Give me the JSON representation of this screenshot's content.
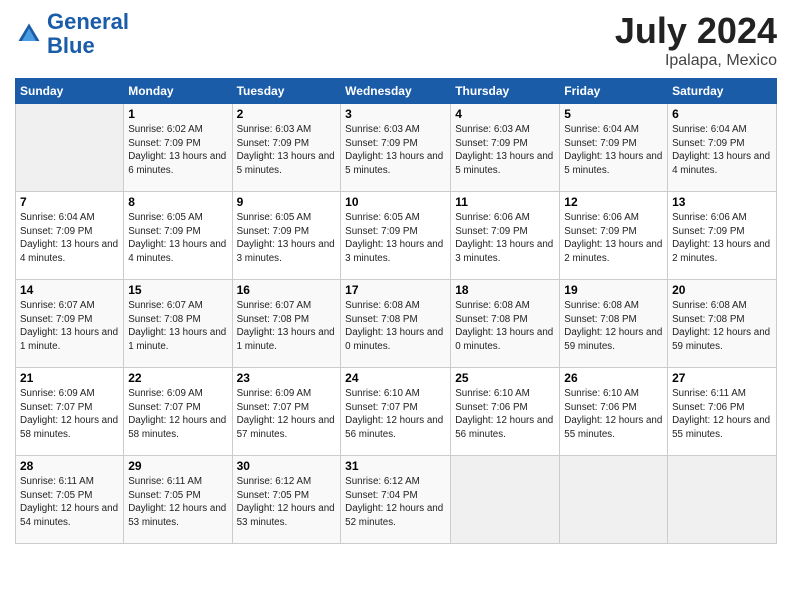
{
  "header": {
    "logo_line1": "General",
    "logo_line2": "Blue",
    "month": "July 2024",
    "location": "Ipalapa, Mexico"
  },
  "days_of_week": [
    "Sunday",
    "Monday",
    "Tuesday",
    "Wednesday",
    "Thursday",
    "Friday",
    "Saturday"
  ],
  "weeks": [
    [
      {
        "day": "",
        "empty": true
      },
      {
        "day": "1",
        "sunrise": "Sunrise: 6:02 AM",
        "sunset": "Sunset: 7:09 PM",
        "daylight": "Daylight: 13 hours and 6 minutes."
      },
      {
        "day": "2",
        "sunrise": "Sunrise: 6:03 AM",
        "sunset": "Sunset: 7:09 PM",
        "daylight": "Daylight: 13 hours and 5 minutes."
      },
      {
        "day": "3",
        "sunrise": "Sunrise: 6:03 AM",
        "sunset": "Sunset: 7:09 PM",
        "daylight": "Daylight: 13 hours and 5 minutes."
      },
      {
        "day": "4",
        "sunrise": "Sunrise: 6:03 AM",
        "sunset": "Sunset: 7:09 PM",
        "daylight": "Daylight: 13 hours and 5 minutes."
      },
      {
        "day": "5",
        "sunrise": "Sunrise: 6:04 AM",
        "sunset": "Sunset: 7:09 PM",
        "daylight": "Daylight: 13 hours and 5 minutes."
      },
      {
        "day": "6",
        "sunrise": "Sunrise: 6:04 AM",
        "sunset": "Sunset: 7:09 PM",
        "daylight": "Daylight: 13 hours and 4 minutes."
      }
    ],
    [
      {
        "day": "7",
        "sunrise": "Sunrise: 6:04 AM",
        "sunset": "Sunset: 7:09 PM",
        "daylight": "Daylight: 13 hours and 4 minutes."
      },
      {
        "day": "8",
        "sunrise": "Sunrise: 6:05 AM",
        "sunset": "Sunset: 7:09 PM",
        "daylight": "Daylight: 13 hours and 4 minutes."
      },
      {
        "day": "9",
        "sunrise": "Sunrise: 6:05 AM",
        "sunset": "Sunset: 7:09 PM",
        "daylight": "Daylight: 13 hours and 3 minutes."
      },
      {
        "day": "10",
        "sunrise": "Sunrise: 6:05 AM",
        "sunset": "Sunset: 7:09 PM",
        "daylight": "Daylight: 13 hours and 3 minutes."
      },
      {
        "day": "11",
        "sunrise": "Sunrise: 6:06 AM",
        "sunset": "Sunset: 7:09 PM",
        "daylight": "Daylight: 13 hours and 3 minutes."
      },
      {
        "day": "12",
        "sunrise": "Sunrise: 6:06 AM",
        "sunset": "Sunset: 7:09 PM",
        "daylight": "Daylight: 13 hours and 2 minutes."
      },
      {
        "day": "13",
        "sunrise": "Sunrise: 6:06 AM",
        "sunset": "Sunset: 7:09 PM",
        "daylight": "Daylight: 13 hours and 2 minutes."
      }
    ],
    [
      {
        "day": "14",
        "sunrise": "Sunrise: 6:07 AM",
        "sunset": "Sunset: 7:09 PM",
        "daylight": "Daylight: 13 hours and 1 minute."
      },
      {
        "day": "15",
        "sunrise": "Sunrise: 6:07 AM",
        "sunset": "Sunset: 7:08 PM",
        "daylight": "Daylight: 13 hours and 1 minute."
      },
      {
        "day": "16",
        "sunrise": "Sunrise: 6:07 AM",
        "sunset": "Sunset: 7:08 PM",
        "daylight": "Daylight: 13 hours and 1 minute."
      },
      {
        "day": "17",
        "sunrise": "Sunrise: 6:08 AM",
        "sunset": "Sunset: 7:08 PM",
        "daylight": "Daylight: 13 hours and 0 minutes."
      },
      {
        "day": "18",
        "sunrise": "Sunrise: 6:08 AM",
        "sunset": "Sunset: 7:08 PM",
        "daylight": "Daylight: 13 hours and 0 minutes."
      },
      {
        "day": "19",
        "sunrise": "Sunrise: 6:08 AM",
        "sunset": "Sunset: 7:08 PM",
        "daylight": "Daylight: 12 hours and 59 minutes."
      },
      {
        "day": "20",
        "sunrise": "Sunrise: 6:08 AM",
        "sunset": "Sunset: 7:08 PM",
        "daylight": "Daylight: 12 hours and 59 minutes."
      }
    ],
    [
      {
        "day": "21",
        "sunrise": "Sunrise: 6:09 AM",
        "sunset": "Sunset: 7:07 PM",
        "daylight": "Daylight: 12 hours and 58 minutes."
      },
      {
        "day": "22",
        "sunrise": "Sunrise: 6:09 AM",
        "sunset": "Sunset: 7:07 PM",
        "daylight": "Daylight: 12 hours and 58 minutes."
      },
      {
        "day": "23",
        "sunrise": "Sunrise: 6:09 AM",
        "sunset": "Sunset: 7:07 PM",
        "daylight": "Daylight: 12 hours and 57 minutes."
      },
      {
        "day": "24",
        "sunrise": "Sunrise: 6:10 AM",
        "sunset": "Sunset: 7:07 PM",
        "daylight": "Daylight: 12 hours and 56 minutes."
      },
      {
        "day": "25",
        "sunrise": "Sunrise: 6:10 AM",
        "sunset": "Sunset: 7:06 PM",
        "daylight": "Daylight: 12 hours and 56 minutes."
      },
      {
        "day": "26",
        "sunrise": "Sunrise: 6:10 AM",
        "sunset": "Sunset: 7:06 PM",
        "daylight": "Daylight: 12 hours and 55 minutes."
      },
      {
        "day": "27",
        "sunrise": "Sunrise: 6:11 AM",
        "sunset": "Sunset: 7:06 PM",
        "daylight": "Daylight: 12 hours and 55 minutes."
      }
    ],
    [
      {
        "day": "28",
        "sunrise": "Sunrise: 6:11 AM",
        "sunset": "Sunset: 7:05 PM",
        "daylight": "Daylight: 12 hours and 54 minutes."
      },
      {
        "day": "29",
        "sunrise": "Sunrise: 6:11 AM",
        "sunset": "Sunset: 7:05 PM",
        "daylight": "Daylight: 12 hours and 53 minutes."
      },
      {
        "day": "30",
        "sunrise": "Sunrise: 6:12 AM",
        "sunset": "Sunset: 7:05 PM",
        "daylight": "Daylight: 12 hours and 53 minutes."
      },
      {
        "day": "31",
        "sunrise": "Sunrise: 6:12 AM",
        "sunset": "Sunset: 7:04 PM",
        "daylight": "Daylight: 12 hours and 52 minutes."
      },
      {
        "day": "",
        "empty": true
      },
      {
        "day": "",
        "empty": true
      },
      {
        "day": "",
        "empty": true
      }
    ]
  ]
}
